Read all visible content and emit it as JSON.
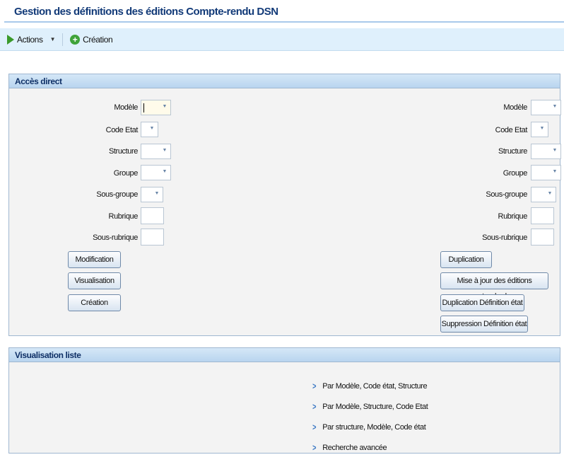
{
  "page": {
    "title": "Gestion des définitions des éditions Compte-rendu DSN"
  },
  "toolbar": {
    "actions_label": "Actions",
    "creation_label": "Création"
  },
  "acces_direct": {
    "header": "Accès direct",
    "left": {
      "modele_label": "Modèle",
      "code_etat_label": "Code Etat",
      "structure_label": "Structure",
      "groupe_label": "Groupe",
      "sous_groupe_label": "Sous-groupe",
      "rubrique_label": "Rubrique",
      "sous_rubrique_label": "Sous-rubrique",
      "buttons": {
        "modification": "Modification",
        "visualisation": "Visualisation",
        "creation": "Création"
      }
    },
    "right": {
      "modele_label": "Modèle",
      "code_etat_label": "Code Etat",
      "structure_label": "Structure",
      "groupe_label": "Groupe",
      "sous_groupe_label": "Sous-groupe",
      "rubrique_label": "Rubrique",
      "sous_rubrique_label": "Sous-rubrique",
      "buttons": {
        "duplication": "Duplication",
        "mise_a_jour": "Mise à jour des éditions standards",
        "duplication_definition": "Duplication Définition état",
        "suppression_definition": "Suppression Définition état"
      }
    }
  },
  "visualisation_liste": {
    "header": "Visualisation liste",
    "links": [
      "Par Modèle, Code état, Structure",
      "Par Modèle, Structure, Code Etat",
      "Par structure, Modèle, Code état",
      "Recherche avancée"
    ]
  }
}
